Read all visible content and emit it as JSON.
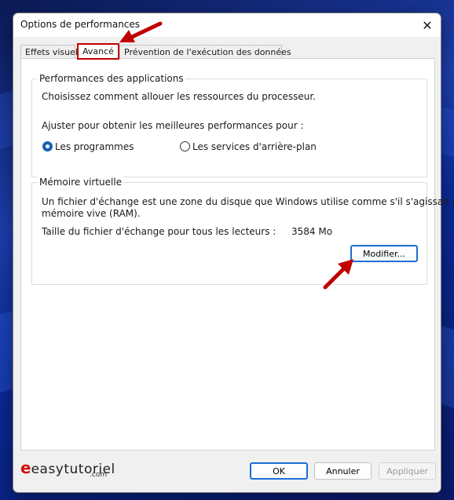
{
  "window": {
    "title": "Options de performances",
    "close_glyph": "✕"
  },
  "tabs": [
    {
      "label": "Effets visuels"
    },
    {
      "label": "Avancé"
    },
    {
      "label": "Prévention de l'exécution des données"
    }
  ],
  "perf_group": {
    "title": "Performances des applications",
    "description": "Choisissez comment allouer les ressources du processeur.",
    "adjust_label": "Ajuster pour obtenir les meilleures performances pour :",
    "option_programs": "Les programmes",
    "option_services": "Les services d'arrière-plan",
    "selected": "programs"
  },
  "vm_group": {
    "title": "Mémoire virtuelle",
    "desc_line1": "Un fichier d'échange est une zone du disque que Windows utilise comme s'il s'agissait de",
    "desc_line2": "mémoire vive (RAM).",
    "size_label": "Taille du fichier d'échange pour tous les lecteurs :",
    "size_value": "3584 Mo",
    "modify_button": "Modifier..."
  },
  "footer": {
    "ok": "OK",
    "cancel": "Annuler",
    "apply": "Appliquer"
  },
  "watermark": {
    "text": "easytutoriel",
    "suffix": ".com"
  },
  "colors": {
    "annotation_red": "#c00000",
    "accent": "#1a5fb4"
  }
}
